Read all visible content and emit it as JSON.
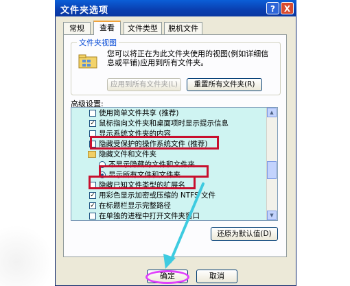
{
  "window": {
    "title": "文件夹选项",
    "help_glyph": "?",
    "close_glyph": "X"
  },
  "tabs": [
    {
      "label": "常规"
    },
    {
      "label": "查看"
    },
    {
      "label": "文件类型"
    },
    {
      "label": "脱机文件"
    }
  ],
  "folder_view": {
    "legend": "文件夹视图",
    "description": "您可以将正在为此文件夹使用的视图(例如详细信息或平铺)应用到所有文件夹。",
    "apply_button": "应用到所有文件夹(L)",
    "reset_button": "重置所有文件夹(R)",
    "icon": "folder-view-icon"
  },
  "advanced": {
    "label": "高级设置:",
    "items": [
      {
        "text": "使用简单文件共享 (推荐)",
        "kind": "checkbox",
        "checked": false
      },
      {
        "text": "鼠标指向文件夹和桌面项时显示提示信息",
        "kind": "checkbox",
        "checked": true
      },
      {
        "text": "显示系统文件夹的内容",
        "kind": "checkbox",
        "checked": false
      },
      {
        "text": "隐藏受保护的操作系统文件 (推荐)",
        "kind": "checkbox",
        "checked": false
      },
      {
        "text": "隐藏文件和文件夹",
        "kind": "folder",
        "checked": false
      },
      {
        "text": "不显示隐藏的文件和文件夹",
        "kind": "radio",
        "checked": false
      },
      {
        "text": "显示所有文件和文件夹",
        "kind": "radio",
        "checked": true
      },
      {
        "text": "隐藏已知文件类型的扩展名",
        "kind": "checkbox",
        "checked": false
      },
      {
        "text": "用彩色显示加密或压缩的 NTFS 文件",
        "kind": "checkbox",
        "checked": true
      },
      {
        "text": "在标题栏显示完整路径",
        "kind": "checkbox",
        "checked": true
      },
      {
        "text": "在单独的进程中打开文件夹窗口",
        "kind": "checkbox",
        "checked": false
      }
    ],
    "restore_button": "还原为默认值(D)"
  },
  "footer": {
    "ok_button": "确定",
    "cancel_button": "取消"
  },
  "colors": {
    "titlebar": "#0a3fb0",
    "listbox_bg": "#cff4f2",
    "highlight_box": "#c8102e",
    "ok_circle": "#e040fb",
    "arrow": "#3ecbe0"
  }
}
